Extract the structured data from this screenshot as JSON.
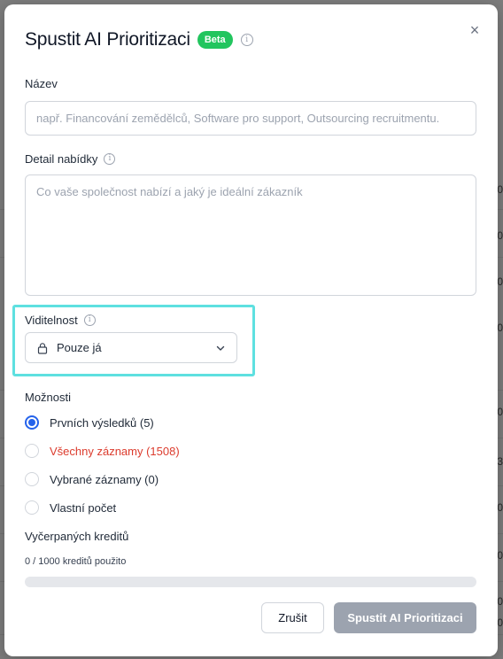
{
  "modal": {
    "title": "Spustit AI Prioritizaci",
    "badge": "Beta",
    "close_glyph": "×"
  },
  "name_field": {
    "label": "Název",
    "placeholder": "např. Financování zemědělců, Software pro support, Outsourcing recruitmentu."
  },
  "detail_field": {
    "label": "Detail nabídky",
    "placeholder": "Co vaše společnost nabízí a jaký je ideální zákazník"
  },
  "visibility": {
    "label": "Viditelnost",
    "value": "Pouze já",
    "highlight_color": "#5ee0e0"
  },
  "options": {
    "label": "Možnosti",
    "items": [
      {
        "label": "Prvních výsledků (5)",
        "checked": true
      },
      {
        "label": "Všechny záznamy (1508)",
        "checked": false,
        "color": "#dc3c2e"
      },
      {
        "label": "Vybrané záznamy (0)",
        "checked": false
      },
      {
        "label": "Vlastní počet",
        "checked": false
      }
    ]
  },
  "credits": {
    "label": "Vyčerpaných kreditů",
    "usage_text": "0 / 1000 kreditů použito",
    "used_fraction": 0
  },
  "footer": {
    "cancel_label": "Zrušit",
    "run_label": "Spustit AI Prioritizaci"
  },
  "background": {
    "edge_labels": [
      "0",
      "0",
      "0",
      "0",
      "0",
      "3",
      "0",
      "0",
      "0",
      "0"
    ]
  },
  "icons": {
    "info": "info-circle-icon",
    "close": "close-icon",
    "lock": "lock-icon",
    "chevron": "chevron-down-icon"
  },
  "colors": {
    "accent": "#2563eb",
    "badge": "#22c55e",
    "disabled_button": "#9ca3af"
  }
}
